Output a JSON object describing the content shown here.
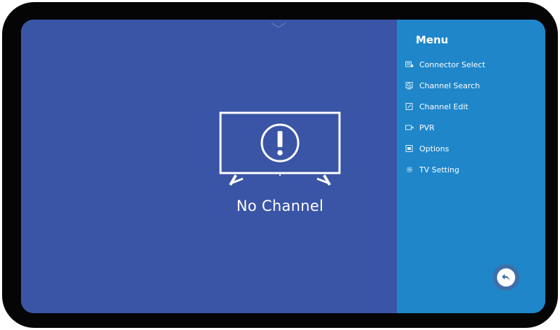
{
  "screen": {
    "status_message": "No Channel",
    "status_icon": "tv-warning-icon"
  },
  "menu": {
    "title": "Menu",
    "items": [
      {
        "label": "Connector Select",
        "icon": "input-source-icon"
      },
      {
        "label": "Channel Search",
        "icon": "channel-search-icon"
      },
      {
        "label": "Channel Edit",
        "icon": "channel-edit-icon"
      },
      {
        "label": "PVR",
        "icon": "record-icon"
      },
      {
        "label": "Options",
        "icon": "options-icon"
      },
      {
        "label": "TV Setting",
        "icon": "gear-icon"
      }
    ]
  },
  "back_button": {
    "icon": "back-arrow-icon"
  },
  "colors": {
    "screen_background": "#3a55a6",
    "menu_background": "#1e86c9",
    "bezel": "#050505",
    "text": "#ffffff"
  }
}
